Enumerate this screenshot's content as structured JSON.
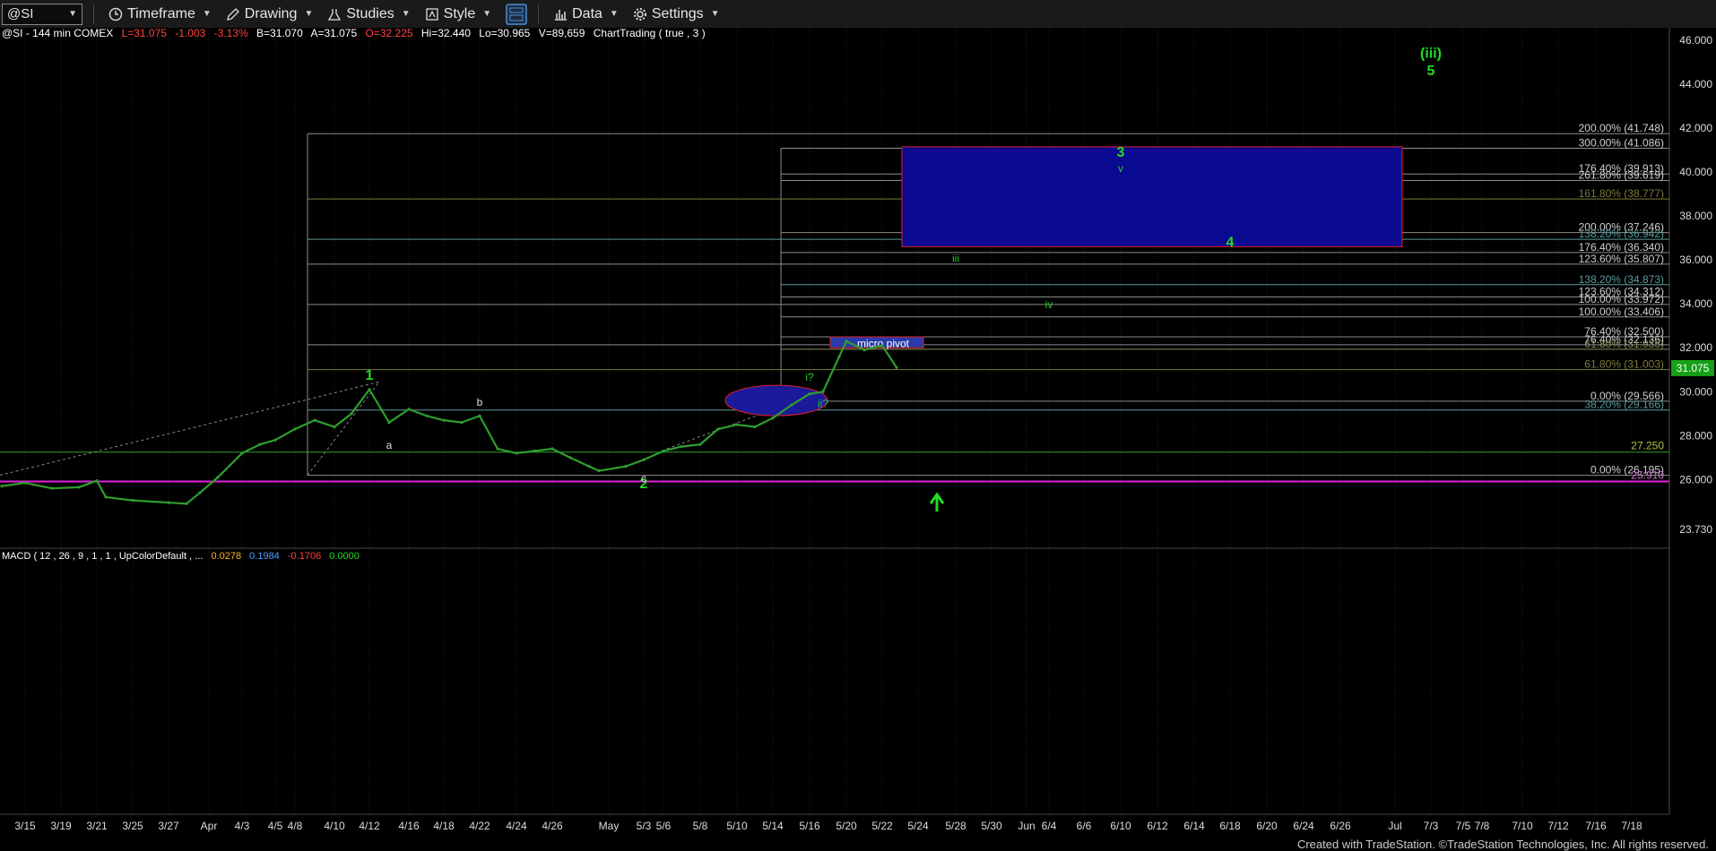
{
  "toolbar": {
    "symbol": "@SI",
    "timeframe": "Timeframe",
    "drawing": "Drawing",
    "studies": "Studies",
    "style": "Style",
    "data": "Data",
    "settings": "Settings"
  },
  "header": {
    "symbol_info": "@SI - 144 min  COMEX",
    "last": "L=31.075",
    "change": "-1.003",
    "change_pct": "-3.13%",
    "bid": "B=31.070",
    "ask": "A=31.075",
    "open": "O=32.225",
    "high": "Hi=32.440",
    "low": "Lo=30.965",
    "volume": "V=89,659",
    "study": "ChartTrading ( true , 3 )"
  },
  "macd": {
    "label": "MACD ( 12 , 26 , 9 , 1 , 1 , UpColorDefault , ...",
    "v1": "0.0278",
    "v2": "0.1984",
    "v3": "-0.1706",
    "v4": "0.0000"
  },
  "credit": "Created with TradeStation. ©TradeStation Technologies, Inc. All rights reserved.",
  "colors": {
    "background": "#000000",
    "price_line": "#2e9e2e",
    "wave_label": "#22dd22",
    "box_fill": "#0a0a90",
    "box_border": "#e02020",
    "support_line": "#e020e0",
    "fib_line": "#8c8c8c",
    "price_tag": "#16a016"
  },
  "chart_data": {
    "type": "line",
    "y_axis": {
      "range": [
        23.73,
        46.0
      ],
      "ticks": [
        "46.000",
        "44.000",
        "42.000",
        "40.000",
        "38.000",
        "36.000",
        "34.000",
        "32.000",
        "30.000",
        "28.000",
        "26.000",
        "23.730"
      ],
      "tick_values": [
        46,
        44,
        42,
        40,
        38,
        36,
        34,
        32,
        30,
        28,
        26,
        23.73
      ]
    },
    "x_axis": {
      "labels": [
        "3/15",
        "3/19",
        "3/21",
        "3/25",
        "3/27",
        "Apr",
        "4/3",
        "4/5",
        "4/8",
        "4/10",
        "4/12",
        "4/16",
        "4/18",
        "4/22",
        "4/24",
        "4/26",
        "May",
        "5/3",
        "5/6",
        "5/8",
        "5/10",
        "5/14",
        "5/16",
        "5/20",
        "5/22",
        "5/24",
        "5/28",
        "5/30",
        "Jun",
        "6/4",
        "6/6",
        "6/10",
        "6/12",
        "6/14",
        "6/18",
        "6/20",
        "6/24",
        "6/26",
        "Jul",
        "7/3",
        "7/5",
        "7/8",
        "7/10",
        "7/12",
        "7/16",
        "7/18"
      ]
    },
    "last_price": "31.075",
    "price_series": [
      {
        "date": "3/13",
        "close": 25.7
      },
      {
        "date": "3/15",
        "close": 25.85
      },
      {
        "date": "3/18",
        "close": 25.6
      },
      {
        "date": "3/20",
        "close": 25.65
      },
      {
        "date": "3/21",
        "close": 25.95
      },
      {
        "date": "3/22",
        "close": 25.2
      },
      {
        "date": "3/25",
        "close": 25.05
      },
      {
        "date": "3/27",
        "close": 24.95
      },
      {
        "date": "3/28",
        "close": 24.9
      },
      {
        "date": "4/1",
        "close": 25.4
      },
      {
        "date": "4/2",
        "close": 26.1
      },
      {
        "date": "4/3",
        "close": 27.2
      },
      {
        "date": "4/4",
        "close": 27.6
      },
      {
        "date": "4/5",
        "close": 27.8
      },
      {
        "date": "4/8",
        "close": 28.3
      },
      {
        "date": "4/9",
        "close": 28.7
      },
      {
        "date": "4/10",
        "close": 28.4
      },
      {
        "date": "4/11",
        "close": 29.0
      },
      {
        "date": "4/12",
        "close": 30.1
      },
      {
        "date": "4/15",
        "close": 28.6
      },
      {
        "date": "4/16",
        "close": 29.2
      },
      {
        "date": "4/17",
        "close": 28.9
      },
      {
        "date": "4/18",
        "close": 28.7
      },
      {
        "date": "4/19",
        "close": 28.6
      },
      {
        "date": "4/22",
        "close": 28.9
      },
      {
        "date": "4/23",
        "close": 27.4
      },
      {
        "date": "4/24",
        "close": 27.2
      },
      {
        "date": "4/25",
        "close": 27.3
      },
      {
        "date": "4/26",
        "close": 27.4
      },
      {
        "date": "4/29",
        "close": 27.0
      },
      {
        "date": "4/30",
        "close": 26.6
      },
      {
        "date": "5/1",
        "close": 26.4
      },
      {
        "date": "5/2",
        "close": 26.6
      },
      {
        "date": "5/3",
        "close": 26.9
      },
      {
        "date": "5/6",
        "close": 27.3
      },
      {
        "date": "5/7",
        "close": 27.5
      },
      {
        "date": "5/8",
        "close": 27.6
      },
      {
        "date": "5/9",
        "close": 28.3
      },
      {
        "date": "5/10",
        "close": 28.5
      },
      {
        "date": "5/13",
        "close": 28.4
      },
      {
        "date": "5/14",
        "close": 28.8
      },
      {
        "date": "5/15",
        "close": 29.4
      },
      {
        "date": "5/16",
        "close": 29.9
      },
      {
        "date": "5/17",
        "close": 30.0
      },
      {
        "date": "5/17b",
        "close": 31.6
      },
      {
        "date": "5/20",
        "close": 32.3
      },
      {
        "date": "5/21",
        "close": 31.9
      },
      {
        "date": "5/22",
        "close": 32.1
      },
      {
        "date": "5/23",
        "close": 31.1
      }
    ],
    "fib_levels": [
      {
        "label": "200.00% (41.748)",
        "value": 41.748
      },
      {
        "label": "300.00% (41.086)",
        "value": 41.086
      },
      {
        "label": "176.40% (39.913)",
        "value": 39.913
      },
      {
        "label": "261.80% (39.619)",
        "value": 39.619
      },
      {
        "label": "161.80% (38.777)",
        "value": 38.777
      },
      {
        "label": "200.00% (37.246)",
        "value": 37.246
      },
      {
        "label": "138.20% (36.942)",
        "value": 36.942
      },
      {
        "label": "176.40% (36.340)",
        "value": 36.34
      },
      {
        "label": "123.60% (35.807)",
        "value": 35.807
      },
      {
        "label": "138.20% (34.873)",
        "value": 34.873
      },
      {
        "label": "123.60% (34.312)",
        "value": 34.312
      },
      {
        "label": "100.00% (33.972)",
        "value": 33.972
      },
      {
        "label": "100.00% (33.406)",
        "value": 33.406
      },
      {
        "label": "76.40% (32.500)",
        "value": 32.5
      },
      {
        "label": "76.40% (32.136)",
        "value": 32.136
      },
      {
        "label": "61.80% (31.935)",
        "value": 31.935
      },
      {
        "label": "61.80% (31.003)",
        "value": 31.003
      },
      {
        "label": "0.00% (29.566)",
        "value": 29.566
      },
      {
        "label": "38.20% (29.166)",
        "value": 29.166
      },
      {
        "label": "0.00% (26.195)",
        "value": 26.195
      }
    ],
    "horizontal_lines": [
      {
        "label": "27.250",
        "value": 27.25
      },
      {
        "label": "25.910",
        "value": 25.91
      }
    ],
    "wave_labels": [
      {
        "text": "1",
        "date": "4/12",
        "value": 30.55
      },
      {
        "text": "2",
        "date": "5/3",
        "value": 25.6
      },
      {
        "text": "3",
        "date": "6/10",
        "value": 40.7
      },
      {
        "text": "4",
        "date": "6/18",
        "value": 36.6
      },
      {
        "text": "5",
        "date": "7/3",
        "value": 44.4
      },
      {
        "text": "(iii)",
        "date": "7/3",
        "value": 45.2
      },
      {
        "text": "a",
        "date": "4/15",
        "value": 27.4
      },
      {
        "text": "b",
        "date": "4/22",
        "value": 29.35
      },
      {
        "text": "c",
        "date": "5/3",
        "value": 25.9
      },
      {
        "text": "i?",
        "date": "5/16",
        "value": 30.5
      },
      {
        "text": "ii?",
        "date": "5/17",
        "value": 29.3
      },
      {
        "text": "iii",
        "date": "5/28",
        "value": 35.9
      },
      {
        "text": "iv",
        "date": "6/4",
        "value": 33.8
      },
      {
        "text": "v",
        "date": "6/10",
        "value": 40.0
      }
    ],
    "annotations": [
      {
        "text": "micro pivot",
        "type": "box",
        "value_top": 32.5,
        "value_bottom": 32.0
      },
      {
        "text": "",
        "type": "target-box",
        "value_top": 41.15,
        "value_bottom": 36.6
      }
    ]
  }
}
